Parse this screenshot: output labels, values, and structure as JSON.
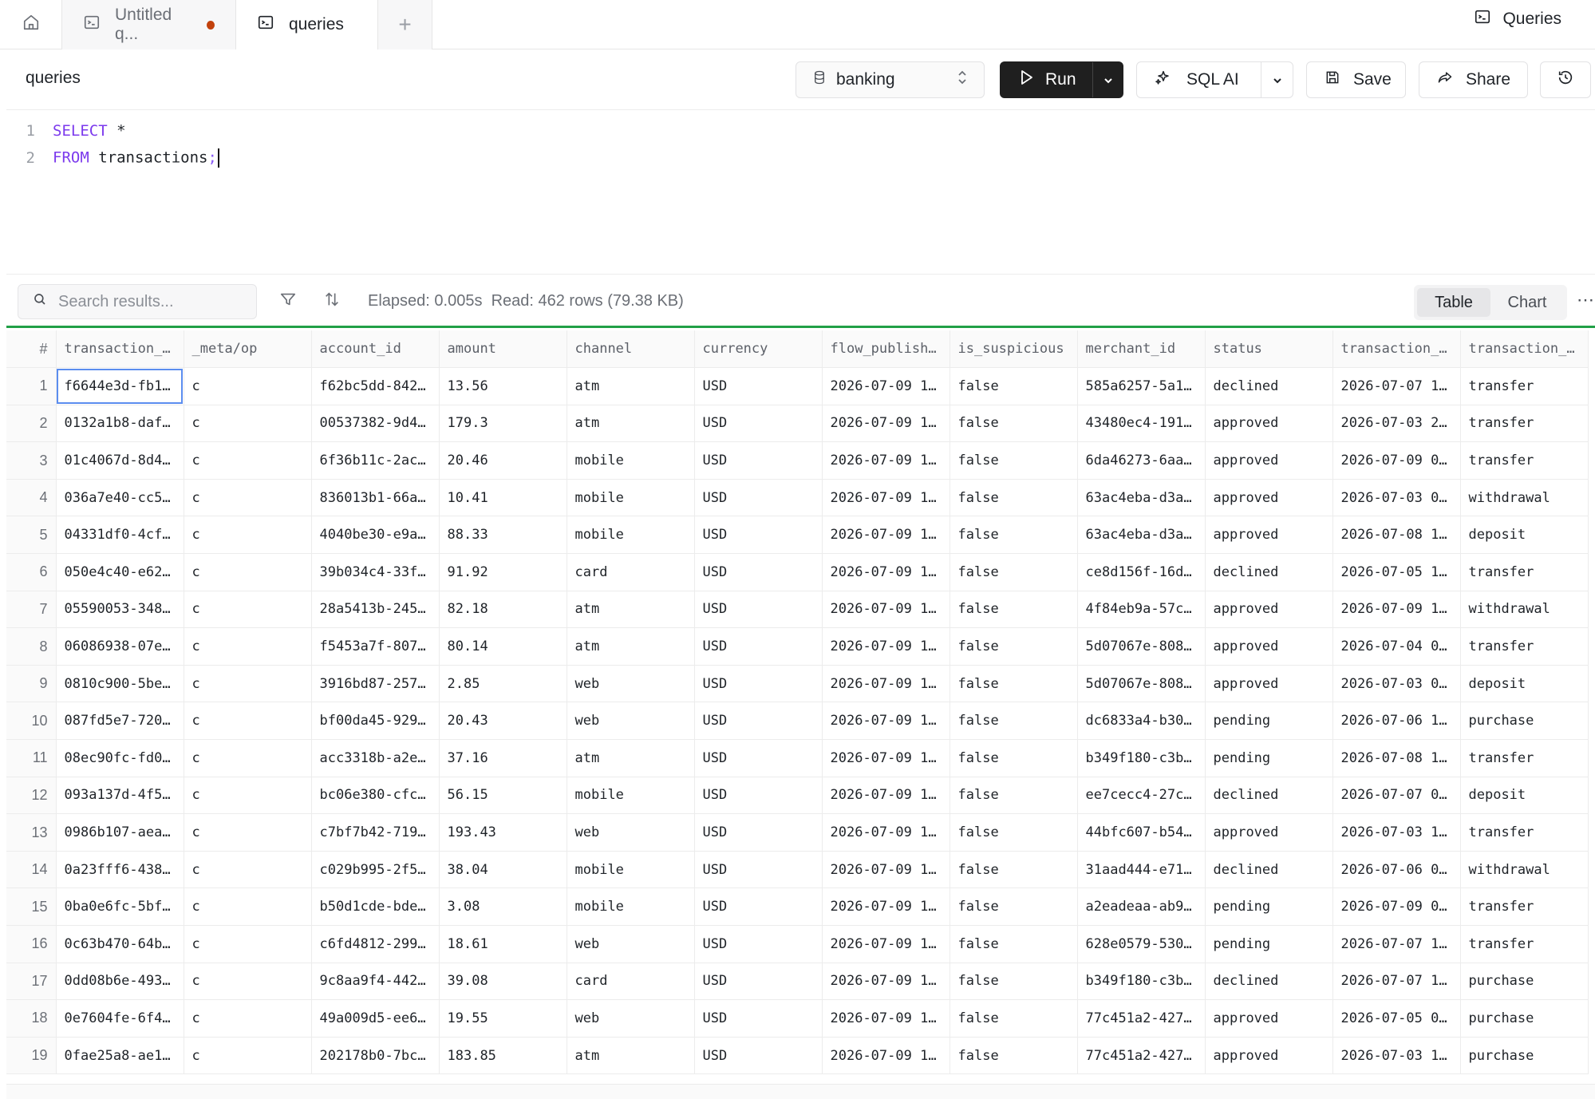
{
  "tabs": {
    "home_icon": "home-icon",
    "items": [
      {
        "label": "Untitled q...",
        "status_color": "#c2410c",
        "active": false
      },
      {
        "label": "queries",
        "status_color": "#16a34a",
        "active": true
      }
    ],
    "add_label": "+",
    "right_link": "Queries"
  },
  "toolbar": {
    "query_name": "queries",
    "database": "banking",
    "run_label": "Run",
    "sql_ai_label": "SQL AI",
    "save_label": "Save",
    "share_label": "Share"
  },
  "editor": {
    "lines": [
      {
        "num": "1",
        "keyword": "SELECT",
        "rest": " *"
      },
      {
        "num": "2",
        "keyword": "FROM",
        "rest": " transactions",
        "punct": ";"
      }
    ]
  },
  "results": {
    "search_placeholder": "Search results...",
    "elapsed": "Elapsed: 0.005s",
    "read": "Read: 462 rows (79.38 KB)",
    "view_options": [
      "Table",
      "Chart"
    ],
    "selected_view": "Table",
    "accent_color": "#21a047"
  },
  "table": {
    "columns": [
      "#",
      "transaction_…",
      "_meta/op",
      "account_id",
      "amount",
      "channel",
      "currency",
      "flow_publish…",
      "is_suspicious",
      "merchant_id",
      "status",
      "transaction_…",
      "transaction_…"
    ],
    "rows": [
      [
        "1",
        "f6644e3d-fb1…",
        "c",
        "f62bc5dd-842…",
        "13.56",
        "atm",
        "USD",
        "2026-07-09 1…",
        "false",
        "585a6257-5a1…",
        "declined",
        "2026-07-07 1…",
        "transfer"
      ],
      [
        "2",
        "0132a1b8-daf…",
        "c",
        "00537382-9d4…",
        "179.3",
        "atm",
        "USD",
        "2026-07-09 1…",
        "false",
        "43480ec4-191…",
        "approved",
        "2026-07-03 2…",
        "transfer"
      ],
      [
        "3",
        "01c4067d-8d4…",
        "c",
        "6f36b11c-2ac…",
        "20.46",
        "mobile",
        "USD",
        "2026-07-09 1…",
        "false",
        "6da46273-6aa…",
        "approved",
        "2026-07-09 0…",
        "transfer"
      ],
      [
        "4",
        "036a7e40-cc5…",
        "c",
        "836013b1-66a…",
        "10.41",
        "mobile",
        "USD",
        "2026-07-09 1…",
        "false",
        "63ac4eba-d3a…",
        "approved",
        "2026-07-03 0…",
        "withdrawal"
      ],
      [
        "5",
        "04331df0-4cf…",
        "c",
        "4040be30-e9a…",
        "88.33",
        "mobile",
        "USD",
        "2026-07-09 1…",
        "false",
        "63ac4eba-d3a…",
        "approved",
        "2026-07-08 1…",
        "deposit"
      ],
      [
        "6",
        "050e4c40-e62…",
        "c",
        "39b034c4-33f…",
        "91.92",
        "card",
        "USD",
        "2026-07-09 1…",
        "false",
        "ce8d156f-16d…",
        "declined",
        "2026-07-05 1…",
        "transfer"
      ],
      [
        "7",
        "05590053-348…",
        "c",
        "28a5413b-245…",
        "82.18",
        "atm",
        "USD",
        "2026-07-09 1…",
        "false",
        "4f84eb9a-57c…",
        "approved",
        "2026-07-09 1…",
        "withdrawal"
      ],
      [
        "8",
        "06086938-07e…",
        "c",
        "f5453a7f-807…",
        "80.14",
        "atm",
        "USD",
        "2026-07-09 1…",
        "false",
        "5d07067e-808…",
        "approved",
        "2026-07-04 0…",
        "transfer"
      ],
      [
        "9",
        "0810c900-5be…",
        "c",
        "3916bd87-257…",
        "2.85",
        "web",
        "USD",
        "2026-07-09 1…",
        "false",
        "5d07067e-808…",
        "approved",
        "2026-07-03 0…",
        "deposit"
      ],
      [
        "10",
        "087fd5e7-720…",
        "c",
        "bf00da45-929…",
        "20.43",
        "web",
        "USD",
        "2026-07-09 1…",
        "false",
        "dc6833a4-b30…",
        "pending",
        "2026-07-06 1…",
        "purchase"
      ],
      [
        "11",
        "08ec90fc-fd0…",
        "c",
        "acc3318b-a2e…",
        "37.16",
        "atm",
        "USD",
        "2026-07-09 1…",
        "false",
        "b349f180-c3b…",
        "pending",
        "2026-07-08 1…",
        "transfer"
      ],
      [
        "12",
        "093a137d-4f5…",
        "c",
        "bc06e380-cfc…",
        "56.15",
        "mobile",
        "USD",
        "2026-07-09 1…",
        "false",
        "ee7cecc4-27c…",
        "declined",
        "2026-07-07 0…",
        "deposit"
      ],
      [
        "13",
        "0986b107-aea…",
        "c",
        "c7bf7b42-719…",
        "193.43",
        "web",
        "USD",
        "2026-07-09 1…",
        "false",
        "44bfc607-b54…",
        "approved",
        "2026-07-03 1…",
        "transfer"
      ],
      [
        "14",
        "0a23fff6-438…",
        "c",
        "c029b995-2f5…",
        "38.04",
        "mobile",
        "USD",
        "2026-07-09 1…",
        "false",
        "31aad444-e71…",
        "declined",
        "2026-07-06 0…",
        "withdrawal"
      ],
      [
        "15",
        "0ba0e6fc-5bf…",
        "c",
        "b50d1cde-bde…",
        "3.08",
        "mobile",
        "USD",
        "2026-07-09 1…",
        "false",
        "a2eadeaa-ab9…",
        "pending",
        "2026-07-09 0…",
        "transfer"
      ],
      [
        "16",
        "0c63b470-64b…",
        "c",
        "c6fd4812-299…",
        "18.61",
        "web",
        "USD",
        "2026-07-09 1…",
        "false",
        "628e0579-530…",
        "pending",
        "2026-07-07 1…",
        "transfer"
      ],
      [
        "17",
        "0dd08b6e-493…",
        "c",
        "9c8aa9f4-442…",
        "39.08",
        "card",
        "USD",
        "2026-07-09 1…",
        "false",
        "b349f180-c3b…",
        "declined",
        "2026-07-07 1…",
        "purchase"
      ],
      [
        "18",
        "0e7604fe-6f4…",
        "c",
        "49a009d5-ee6…",
        "19.55",
        "web",
        "USD",
        "2026-07-09 1…",
        "false",
        "77c451a2-427…",
        "approved",
        "2026-07-05 0…",
        "purchase"
      ],
      [
        "19",
        "0fae25a8-ae1…",
        "c",
        "202178b0-7bc…",
        "183.85",
        "atm",
        "USD",
        "2026-07-09 1…",
        "false",
        "77c451a2-427…",
        "approved",
        "2026-07-03 1…",
        "purchase"
      ]
    ]
  }
}
